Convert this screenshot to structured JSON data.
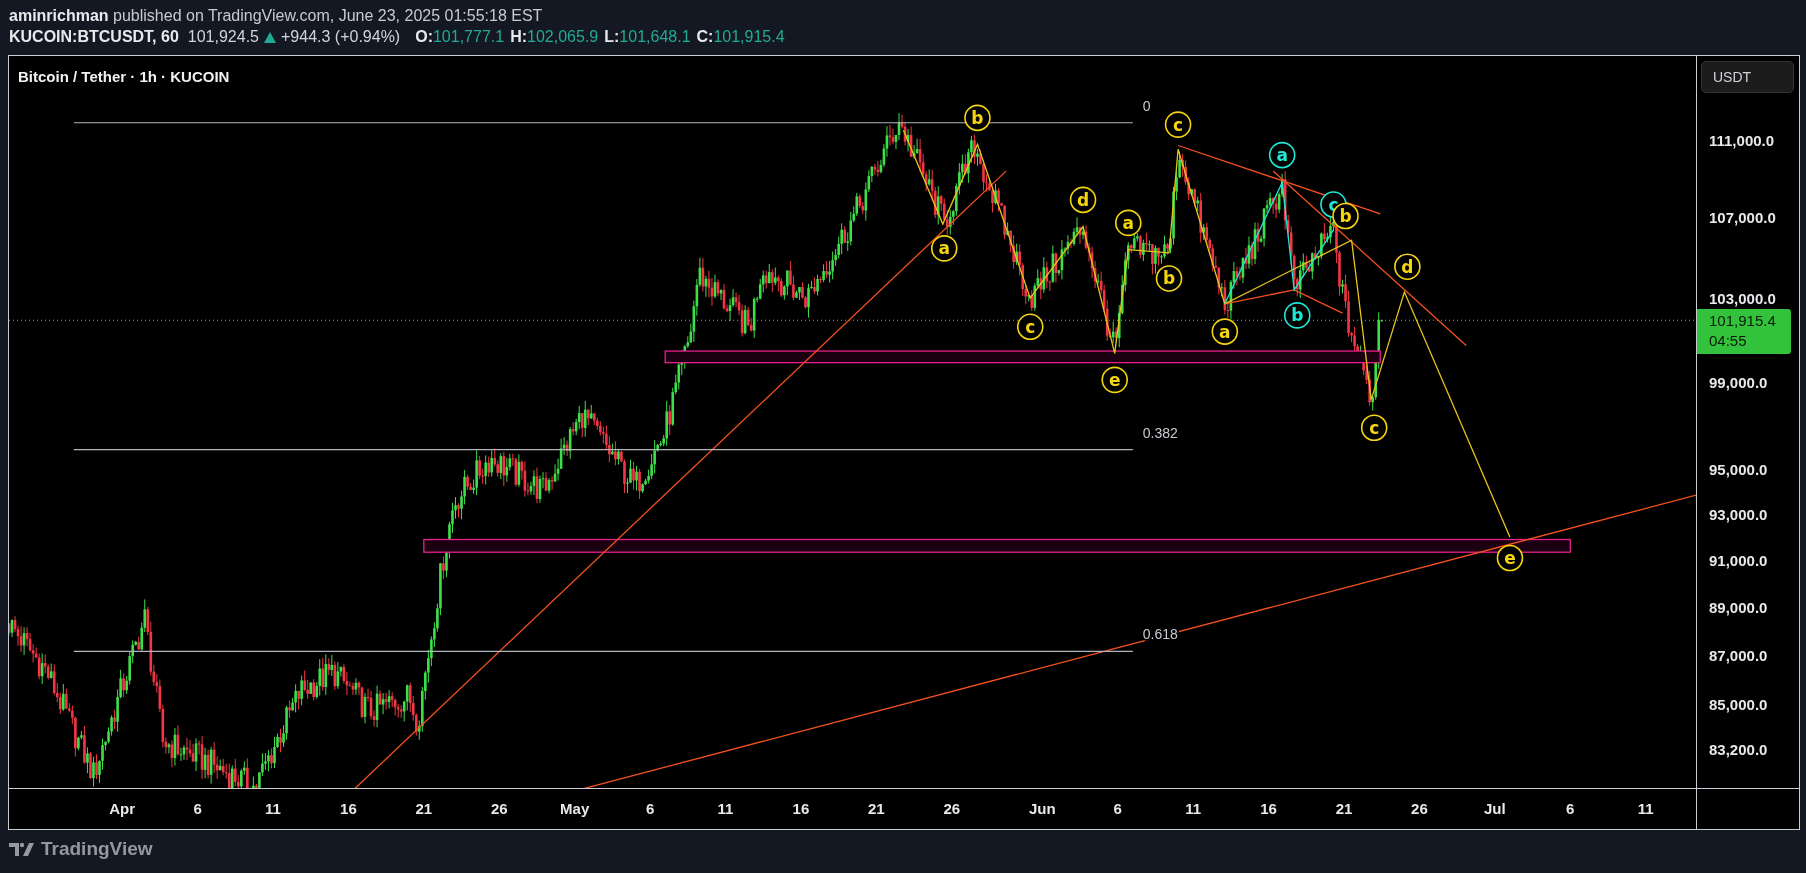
{
  "header": {
    "attribution": "**aminrichman** published on TradingView.com, June 23, 2025 01:55:18 EST",
    "symbol": "KUCOIN:BTCUSDT, 60",
    "last": "101,924.5",
    "up": true,
    "change": "+944.3 (+0.94%)",
    "ohlc": [
      {
        "label": "O:",
        "value": "101,777.1"
      },
      {
        "label": "H:",
        "value": "102,065.9"
      },
      {
        "label": "L:",
        "value": "101,648.1"
      },
      {
        "label": "C:",
        "value": "101,915.4"
      }
    ]
  },
  "chart": {
    "title": "Bitcoin / Tether · 1h · KUCOIN",
    "currency_button": "USDT",
    "price_tag": {
      "price": "101,915.4",
      "countdown": "04:55"
    },
    "fib_levels": [
      {
        "label": "0"
      },
      {
        "label": "0.382"
      },
      {
        "label": "0.618"
      }
    ],
    "wave_labels": [
      {
        "text": "b",
        "color": "#f5d60c"
      },
      {
        "text": "a",
        "color": "#f5d60c"
      },
      {
        "text": "c",
        "color": "#f5d60c"
      },
      {
        "text": "a",
        "color": "#1de9d6"
      },
      {
        "text": "c",
        "color": "#1de9d6"
      },
      {
        "text": "b",
        "color": "#f5d60c"
      },
      {
        "text": "d",
        "color": "#f5d60c"
      },
      {
        "text": "a",
        "color": "#f5d60c"
      },
      {
        "text": "d",
        "color": "#f5d60c"
      },
      {
        "text": "b",
        "color": "#f5d60c"
      },
      {
        "text": "c",
        "color": "#f5d60c"
      },
      {
        "text": "b",
        "color": "#1de9d6"
      },
      {
        "text": "a",
        "color": "#f5d60c"
      },
      {
        "text": "e",
        "color": "#f5d60c"
      },
      {
        "text": "c",
        "color": "#f5d60c"
      },
      {
        "text": "e",
        "color": "#f5d60c"
      }
    ],
    "price_axis": [
      "111,000.0",
      "107,000.0",
      "103,000.0",
      "99,000.0",
      "95,000.0",
      "93,000.0",
      "91,000.0",
      "89,000.0",
      "87,000.0",
      "85,000.0",
      "83,200.0"
    ],
    "time_axis": [
      "Apr",
      "6",
      "11",
      "16",
      "21",
      "26",
      "May",
      "6",
      "11",
      "16",
      "21",
      "26",
      "Jun",
      "6",
      "11",
      "16",
      "21",
      "26",
      "Jul",
      "6",
      "11"
    ]
  },
  "footer": {
    "brand": "TradingView"
  }
}
